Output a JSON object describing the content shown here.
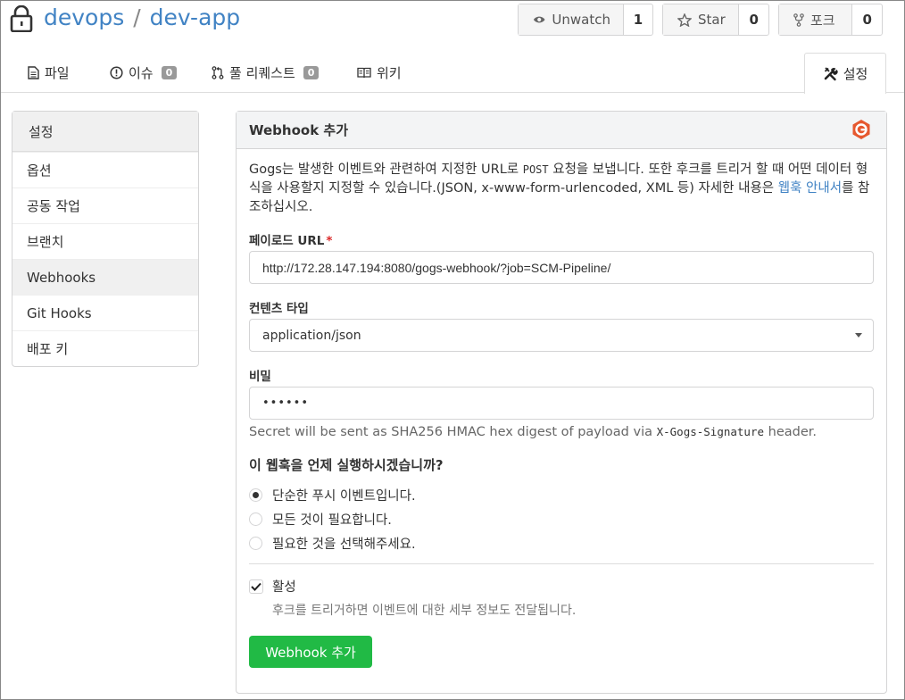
{
  "repo": {
    "owner": "devops",
    "separator": "/",
    "name": "dev-app"
  },
  "actions": {
    "watch": {
      "label": "Unwatch",
      "count": "1"
    },
    "star": {
      "label": "Star",
      "count": "0"
    },
    "fork": {
      "label": "포크",
      "count": "0"
    }
  },
  "tabs": {
    "files": {
      "label": "파일"
    },
    "issues": {
      "label": "이슈",
      "count": "0"
    },
    "pulls": {
      "label": "풀 리퀘스트",
      "count": "0"
    },
    "wiki": {
      "label": "위키"
    },
    "settings": {
      "label": "설정"
    }
  },
  "sidebar": {
    "title": "설정",
    "items": [
      {
        "label": "옵션"
      },
      {
        "label": "공동 작업"
      },
      {
        "label": "브랜치"
      },
      {
        "label": "Webhooks",
        "active": true
      },
      {
        "label": "Git Hooks"
      },
      {
        "label": "배포 키"
      }
    ]
  },
  "panel": {
    "title": "Webhook 추가",
    "description": {
      "part1": "Gogs는 발생한 이벤트와 관련하여 지정한 URL로 ",
      "post": "POST",
      "part2": " 요청을 보냅니다. 또한 후크를 트리거 할 때 어떤 데이터 형식을 사용할지 지정할 수 있습니다.(JSON, x-www-form-urlencoded, XML 등) 자세한 내용은 ",
      "link": "웹훅 안내서",
      "part3": "를 참조하십시오."
    },
    "payload_url": {
      "label": "페이로드 URL",
      "required_mark": "*",
      "value": "http://172.28.147.194:8080/gogs-webhook/?job=SCM-Pipeline/"
    },
    "content_type": {
      "label": "컨텐츠 타입",
      "value": "application/json"
    },
    "secret": {
      "label": "비밀",
      "value": "••••••",
      "help_prefix": "Secret will be sent as SHA256 HMAC hex digest of payload via ",
      "help_code": "X-Gogs-Signature",
      "help_suffix": " header."
    },
    "trigger": {
      "question": "이 웹훅을 언제 실행하시겠습니까?",
      "options": [
        {
          "label": "단순한 푸시 이벤트입니다.",
          "checked": true
        },
        {
          "label": "모든 것이 필요합니다.",
          "checked": false
        },
        {
          "label": "필요한 것을 선택해주세요.",
          "checked": false
        }
      ]
    },
    "active": {
      "label": "활성",
      "checked": true,
      "help": "후크를 트리거하면 이벤트에 대한 세부 정보도 전달됩니다."
    },
    "submit_label": "Webhook 추가"
  },
  "colors": {
    "link": "#4183c4",
    "submit": "#21ba45",
    "required": "#db2828"
  }
}
